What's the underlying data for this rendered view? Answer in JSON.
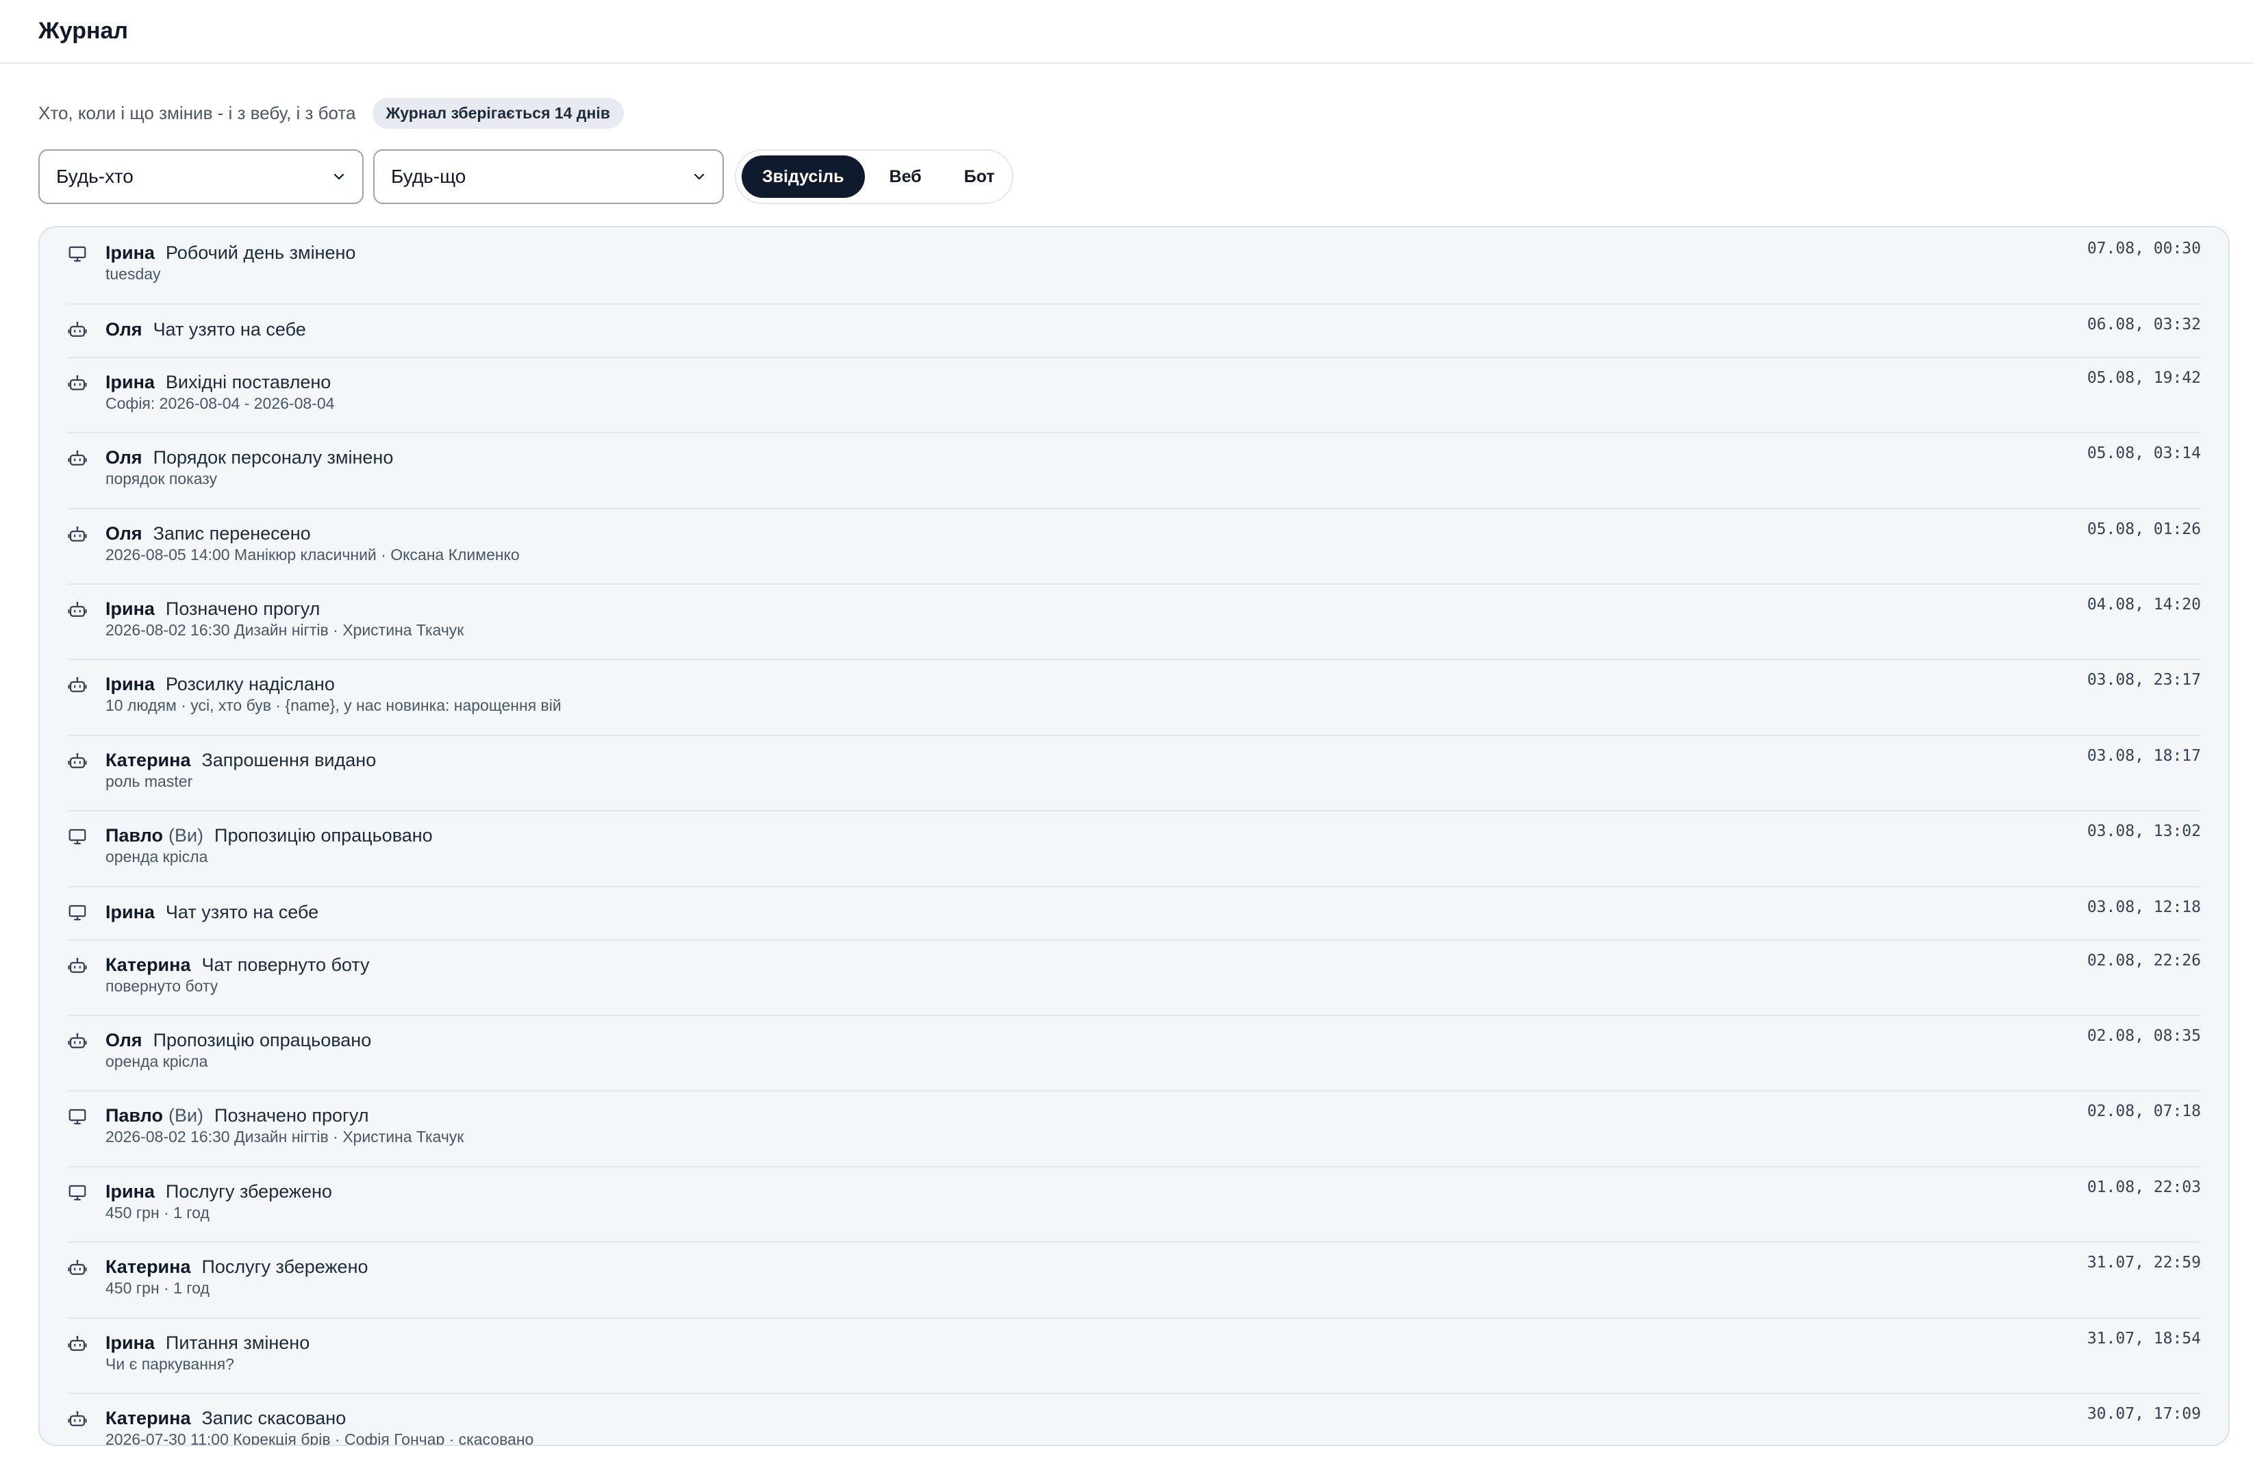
{
  "header": {
    "title": "Журнал"
  },
  "subtitle": "Хто, коли і що змінив - і з вебу, і з бота",
  "retention_badge": "Журнал зберігається 14 днів",
  "filters": {
    "who": "Будь-хто",
    "what": "Будь-що",
    "source": [
      {
        "label": "Звідусіль",
        "active": true
      },
      {
        "label": "Веб",
        "active": false
      },
      {
        "label": "Бот",
        "active": false
      }
    ]
  },
  "log": [
    {
      "source": "web",
      "icon": "monitor-icon",
      "actor": "Ірина",
      "you": "",
      "action": "Робочий день змінено",
      "detail": "tuesday",
      "time": "07.08, 00:30"
    },
    {
      "source": "bot",
      "icon": "bot-icon",
      "actor": "Оля",
      "you": "",
      "action": "Чат узято на себе",
      "detail": "",
      "time": "06.08, 03:32"
    },
    {
      "source": "bot",
      "icon": "bot-icon",
      "actor": "Ірина",
      "you": "",
      "action": "Вихідні поставлено",
      "detail": "Софія: 2026-08-04 - 2026-08-04",
      "time": "05.08, 19:42"
    },
    {
      "source": "bot",
      "icon": "bot-icon",
      "actor": "Оля",
      "you": "",
      "action": "Порядок персоналу змінено",
      "detail": "порядок показу",
      "time": "05.08, 03:14"
    },
    {
      "source": "bot",
      "icon": "bot-icon",
      "actor": "Оля",
      "you": "",
      "action": "Запис перенесено",
      "detail": "2026-08-05 14:00 Манікюр класичний · Оксана Клименко",
      "time": "05.08, 01:26"
    },
    {
      "source": "bot",
      "icon": "bot-icon",
      "actor": "Ірина",
      "you": "",
      "action": "Позначено прогул",
      "detail": "2026-08-02 16:30 Дизайн нігтів · Христина Ткачук",
      "time": "04.08, 14:20"
    },
    {
      "source": "bot",
      "icon": "bot-icon",
      "actor": "Ірина",
      "you": "",
      "action": "Розсилку надіслано",
      "detail": "10 людям · усі, хто був · {name}, у нас новинка: нарощення вій",
      "time": "03.08, 23:17"
    },
    {
      "source": "bot",
      "icon": "bot-icon",
      "actor": "Катерина",
      "you": "",
      "action": "Запрошення видано",
      "detail": "роль master",
      "time": "03.08, 18:17"
    },
    {
      "source": "web",
      "icon": "monitor-icon",
      "actor": "Павло",
      "you": "(Ви)",
      "action": "Пропозицію опрацьовано",
      "detail": "оренда крісла",
      "time": "03.08, 13:02"
    },
    {
      "source": "web",
      "icon": "monitor-icon",
      "actor": "Ірина",
      "you": "",
      "action": "Чат узято на себе",
      "detail": "",
      "time": "03.08, 12:18"
    },
    {
      "source": "bot",
      "icon": "bot-icon",
      "actor": "Катерина",
      "you": "",
      "action": "Чат повернуто боту",
      "detail": "повернуто боту",
      "time": "02.08, 22:26"
    },
    {
      "source": "bot",
      "icon": "bot-icon",
      "actor": "Оля",
      "you": "",
      "action": "Пропозицію опрацьовано",
      "detail": "оренда крісла",
      "time": "02.08, 08:35"
    },
    {
      "source": "web",
      "icon": "monitor-icon",
      "actor": "Павло",
      "you": "(Ви)",
      "action": "Позначено прогул",
      "detail": "2026-08-02 16:30 Дизайн нігтів · Христина Ткачук",
      "time": "02.08, 07:18"
    },
    {
      "source": "web",
      "icon": "monitor-icon",
      "actor": "Ірина",
      "you": "",
      "action": "Послугу збережено",
      "detail": "450 грн · 1 год",
      "time": "01.08, 22:03"
    },
    {
      "source": "bot",
      "icon": "bot-icon",
      "actor": "Катерина",
      "you": "",
      "action": "Послугу збережено",
      "detail": "450 грн · 1 год",
      "time": "31.07, 22:59"
    },
    {
      "source": "bot",
      "icon": "bot-icon",
      "actor": "Ірина",
      "you": "",
      "action": "Питання змінено",
      "detail": "Чи є паркування?",
      "time": "31.07, 18:54"
    },
    {
      "source": "bot",
      "icon": "bot-icon",
      "actor": "Катерина",
      "you": "",
      "action": "Запис скасовано",
      "detail": "2026-07-30 11:00 Корекція брів · Софія Гончар · скасовано",
      "time": "30.07, 17:09"
    }
  ]
}
